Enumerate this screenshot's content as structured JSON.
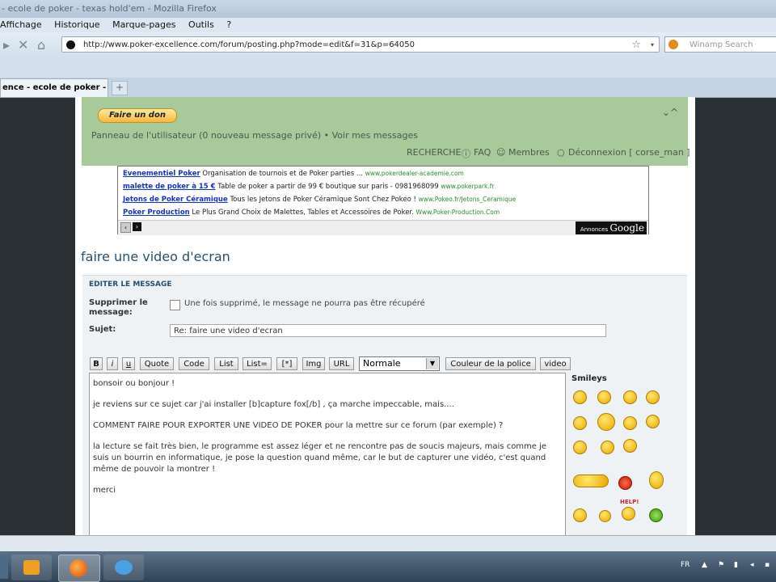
{
  "browser": {
    "title": "- ecole de poker - texas hold'em - Mozilla Firefox",
    "menu": [
      "Affichage",
      "Historique",
      "Marque-pages",
      "Outils",
      "?"
    ],
    "url": "http://www.poker-excellence.com/forum/posting.php?mode=edit&f=31&p=64050",
    "search_placeholder": "Winamp Search",
    "tab_label": "ence - ecole de poker - t...",
    "new_tab": "+"
  },
  "header": {
    "donate": "Faire un don",
    "user_panel": "Panneau de l'utilisateur (0 nouveau message privé) • Voir mes messages",
    "links": {
      "search": "RECHERCHE",
      "faq": "FAQ",
      "members": "Membres",
      "logout": "Déconnexion [ corse_man ]"
    }
  },
  "ads": {
    "items": [
      {
        "title": "Evenementiel Poker",
        "text": "Organisation de tournois et de Poker parties ...",
        "url": "www.pokerdealer-academie.com"
      },
      {
        "title": "malette de poker à 15 €",
        "text": "Table de poker a partir de 99 € boutique sur paris - 0981968099",
        "url": "www.pokerpark.fr"
      },
      {
        "title": "Jetons de Poker Céramique",
        "text": "Tous les Jetons de Poker Céramique Sont Chez Pokeo !",
        "url": "www.Pokeo.fr/Jetons_Ceramique"
      },
      {
        "title": "Poker Production",
        "text": "Le Plus Grand Choix de Malettes, Tables et Accessoires de Poker.",
        "url": "Www.Poker-Production.Com"
      }
    ],
    "annonces": "Annonces",
    "google": "Google"
  },
  "topic": {
    "title": "faire une video d'ecran"
  },
  "form": {
    "section": "EDITER LE MESSAGE",
    "delete_label": "Supprimer le message:",
    "delete_note": "Une fois supprimé, le message ne pourra pas être récupéré",
    "subject_label": "Sujet:",
    "subject_value": "Re: faire une video d'ecran",
    "toolbar": [
      "B",
      "i",
      "u",
      "Quote",
      "Code",
      "List",
      "List=",
      "[*]",
      "Img",
      "URL"
    ],
    "font_size": "Normale",
    "font_color": "Couleur de la police",
    "video": "video",
    "message_lines": [
      "bonsoir ou bonjour !",
      "je reviens sur ce sujet car j'ai installer [b]capture fox[/b] , ça marche impeccable, mais....",
      "COMMENT FAIRE POUR EXPORTER UNE VIDEO DE POKER  pour la mettre sur ce forum (par exemple) ?",
      "la lecture se fait très bien, le programme est assez léger et ne rencontre pas de soucis majeurs, mais comme je suis un bourrin en informatique, je pose la question quand même, car le but de capturer une vidéo, c'est quand même de pouvoir la montrer !",
      "merci"
    ],
    "smileys_label": "Smileys",
    "help_label": "HELP!"
  },
  "taskbar": {
    "lang": "FR"
  }
}
